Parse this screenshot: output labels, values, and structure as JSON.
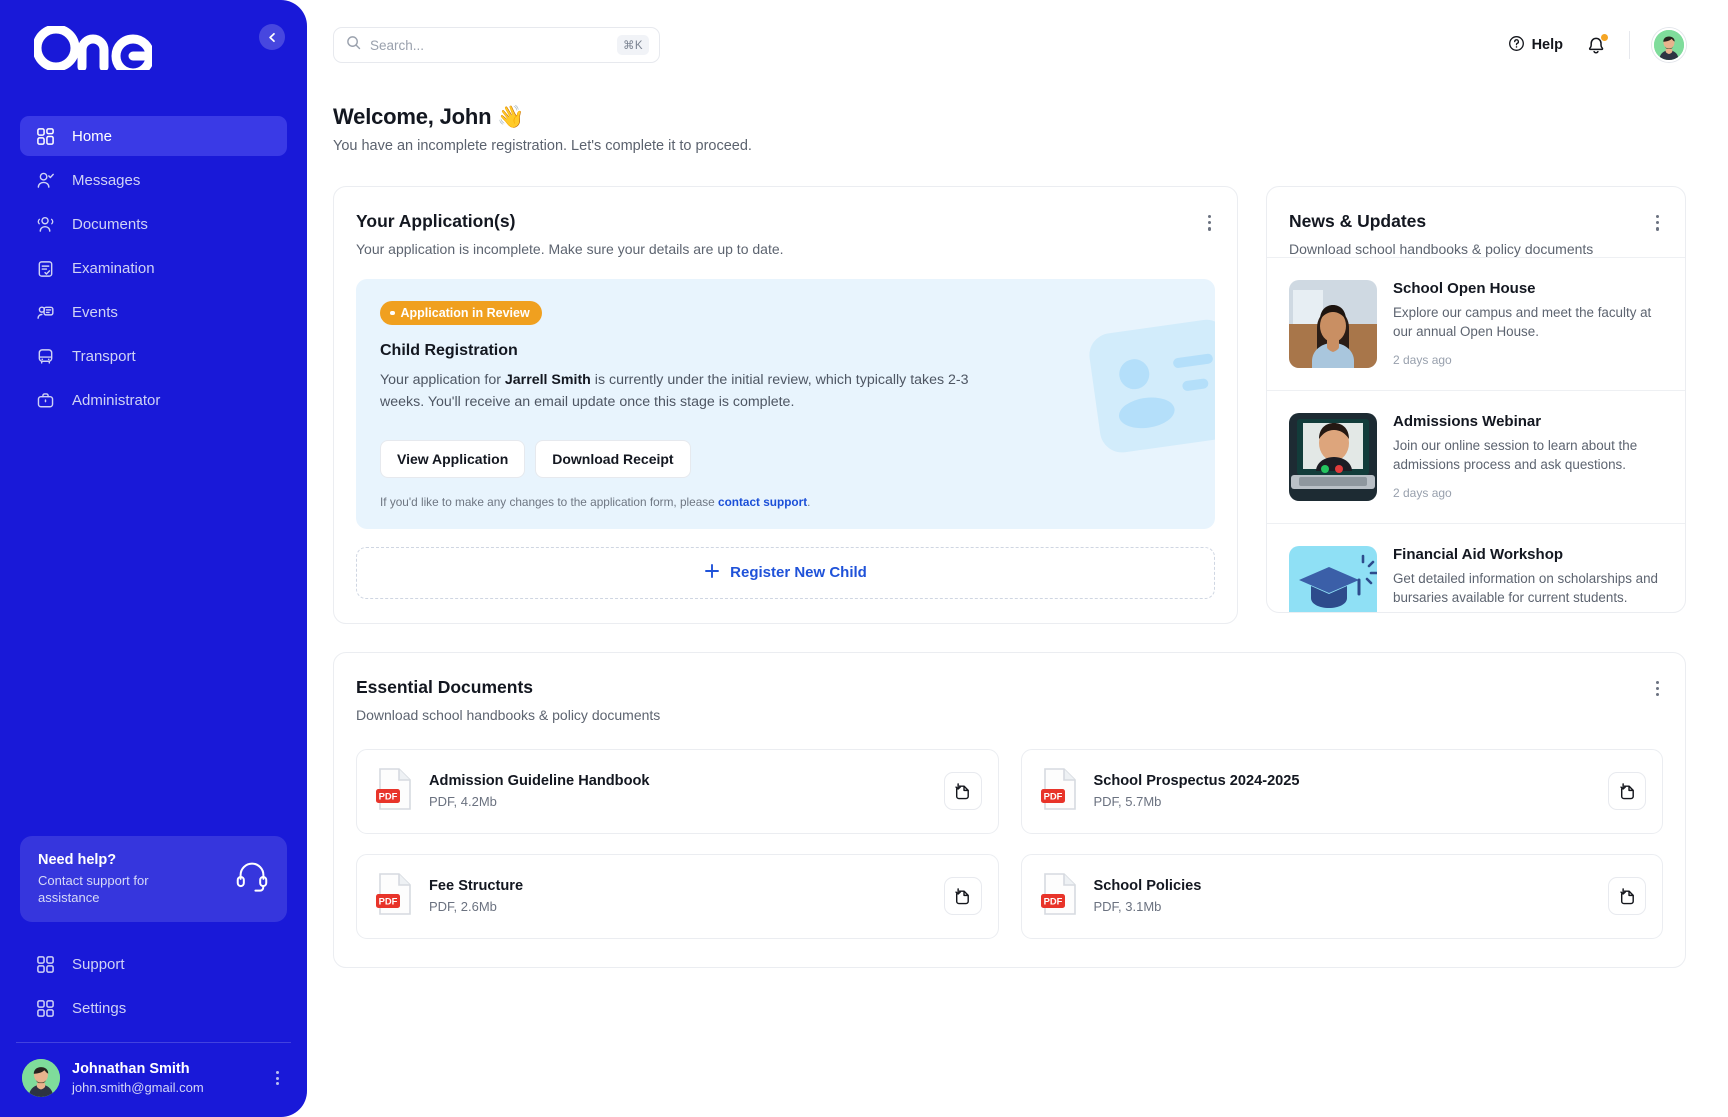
{
  "sidebar": {
    "logo_text": "one",
    "collapse_icon": "chevron-left-icon",
    "items": [
      {
        "label": "Home",
        "icon": "grid-icon",
        "active": true
      },
      {
        "label": "Messages",
        "icon": "user-check-icon",
        "active": false
      },
      {
        "label": "Documents",
        "icon": "users-icon",
        "active": false
      },
      {
        "label": "Examination",
        "icon": "clipboard-check-icon",
        "active": false
      },
      {
        "label": "Events",
        "icon": "chat-user-icon",
        "active": false
      },
      {
        "label": "Transport",
        "icon": "bus-icon",
        "active": false
      },
      {
        "label": "Administrator",
        "icon": "briefcase-icon",
        "active": false
      }
    ],
    "help_card": {
      "title": "Need help?",
      "subtitle": "Contact support for assistance",
      "icon": "headset-icon"
    },
    "bottom_items": [
      {
        "label": "Support",
        "icon": "grid-icon"
      },
      {
        "label": "Settings",
        "icon": "grid-icon"
      }
    ],
    "profile": {
      "name": "Johnathan Smith",
      "email": "john.smith@gmail.com",
      "avatar": "user-avatar",
      "menu_icon": "more-vertical-icon"
    }
  },
  "topbar": {
    "search": {
      "value": "",
      "placeholder": "Search...",
      "icon": "search-icon",
      "shortcut": "⌘K"
    },
    "help_label": "Help",
    "help_icon": "question-circle-icon",
    "notifications_icon": "bell-icon",
    "avatar": "user-avatar"
  },
  "page": {
    "greeting": "Welcome, John 👋",
    "subtitle": "You have an incomplete registration. Let's complete it to proceed."
  },
  "applications": {
    "title": "Your Application(s)",
    "subtitle": "Your application is incomplete. Make sure your details are up to date.",
    "menu_icon": "more-vertical-icon",
    "status_badge": "Application in Review",
    "status_color": "#f0a01f",
    "entry_title": "Child Registration",
    "body_pre": "Your application for ",
    "body_name": "Jarrell Smith",
    "body_post": " is currently under the initial review, which typically takes 2-3 weeks. You'll receive an email update once this stage is complete.",
    "view_label": "View Application",
    "receipt_label": "Download Receipt",
    "note_pre": "If you'd like to make any changes to the application form, please ",
    "note_link": "contact support",
    "note_post": ".",
    "register_label": "Register New Child",
    "register_icon": "plus-icon"
  },
  "news": {
    "title": "News & Updates",
    "subtitle": "Download school handbooks & policy documents",
    "menu_icon": "more-vertical-icon",
    "items": [
      {
        "title": "School Open House",
        "description": "Explore our campus and meet the faculty at our annual Open House.",
        "time": "2 days ago",
        "thumb": "student-photo"
      },
      {
        "title": "Admissions Webinar",
        "description": "Join our online session to learn about the admissions process and ask questions.",
        "time": "2 days ago",
        "thumb": "webinar-photo"
      },
      {
        "title": "Financial Aid Workshop",
        "description": "Get detailed information on scholarships and bursaries available for current students.",
        "time": "",
        "thumb": "graduation-cap-illustration"
      }
    ]
  },
  "documents": {
    "title": "Essential Documents",
    "subtitle": "Download school handbooks & policy documents",
    "menu_icon": "more-vertical-icon",
    "items": [
      {
        "name": "Admission Guideline Handbook",
        "meta": "PDF, 4.2Mb",
        "type": "PDF",
        "action_icon": "download-file-icon"
      },
      {
        "name": "School Prospectus 2024-2025",
        "meta": "PDF, 5.7Mb",
        "type": "PDF",
        "action_icon": "download-file-icon"
      },
      {
        "name": "Fee Structure",
        "meta": "PDF, 2.6Mb",
        "type": "PDF",
        "action_icon": "download-file-icon"
      },
      {
        "name": "School Policies",
        "meta": "PDF, 3.1Mb",
        "type": "PDF",
        "action_icon": "download-file-icon"
      }
    ]
  },
  "colors": {
    "brand_blue": "#1919d8",
    "accent_blue": "#1f52d9",
    "status_orange": "#f0a01f",
    "pdf_red": "#e8342a",
    "info_bg": "#e8f4fd"
  }
}
